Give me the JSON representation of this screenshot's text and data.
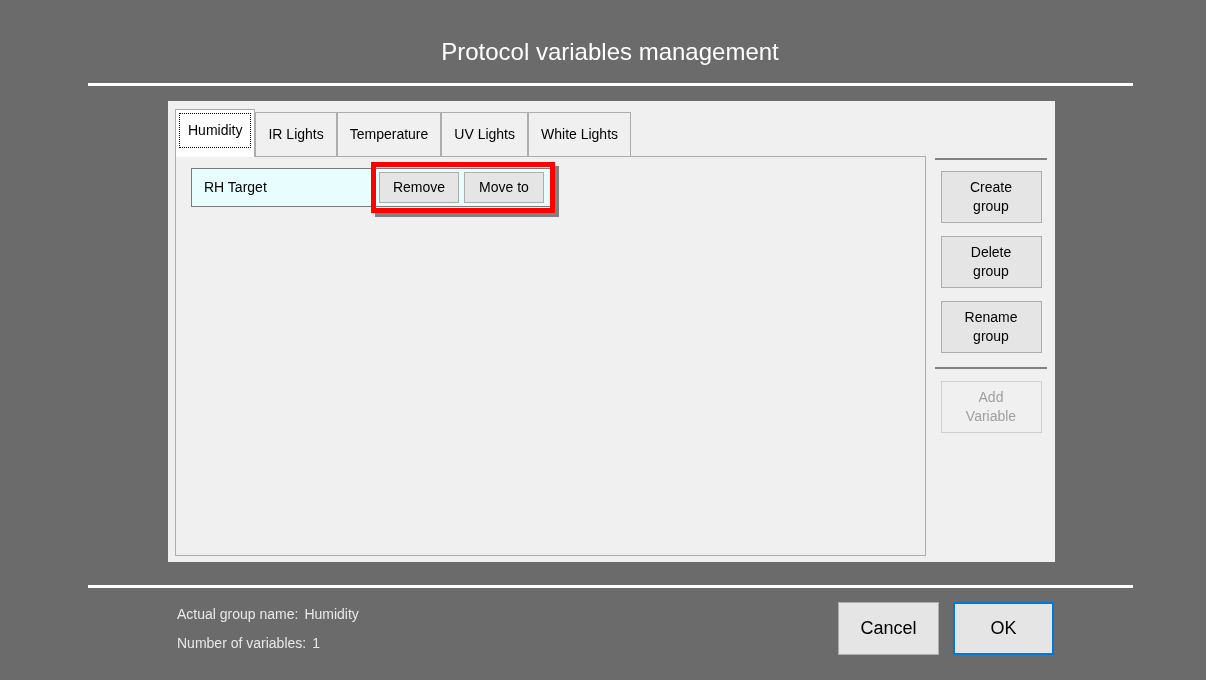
{
  "dialog": {
    "title": "Protocol variables management",
    "tabs": [
      {
        "label": "Humidity",
        "selected": true
      },
      {
        "label": "IR Lights",
        "selected": false
      },
      {
        "label": "Temperature",
        "selected": false
      },
      {
        "label": "UV Lights",
        "selected": false
      },
      {
        "label": "White Lights",
        "selected": false
      }
    ],
    "variables": [
      {
        "name": "RH Target",
        "actions": [
          "Remove",
          "Move to"
        ],
        "highlighted": true
      }
    ],
    "group_buttons": [
      {
        "label": "Create\ngroup",
        "disabled": false
      },
      {
        "label": "Delete\ngroup",
        "disabled": false
      },
      {
        "label": "Rename\ngroup",
        "disabled": false
      }
    ],
    "variable_buttons": [
      {
        "label": "Add\nVariable",
        "disabled": true
      }
    ],
    "info": [
      {
        "label": "Actual group name:",
        "value": "Humidity"
      },
      {
        "label": "Number of variables:",
        "value": "1"
      }
    ],
    "buttons": [
      {
        "label": "Cancel",
        "default": false
      },
      {
        "label": "OK",
        "default": true
      }
    ]
  }
}
